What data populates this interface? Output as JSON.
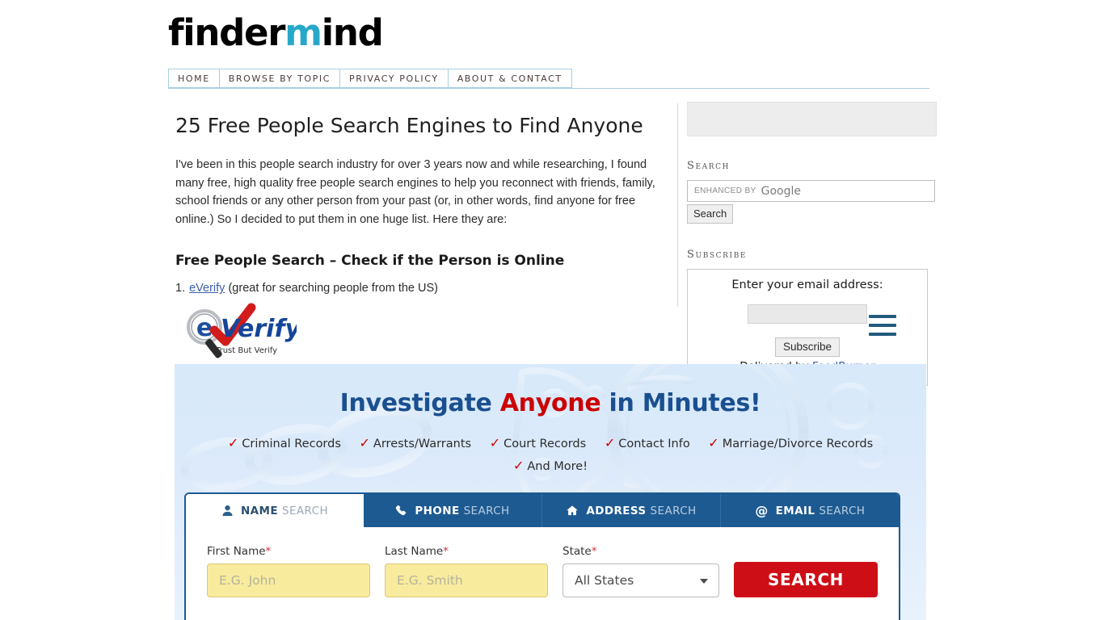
{
  "site": {
    "logo_first": "finder",
    "logo_accent": "m",
    "logo_last": "ind",
    "accent_color": "#28a8c8"
  },
  "nav": {
    "items": [
      {
        "label": "HOME"
      },
      {
        "label": "BROWSE BY TOPIC"
      },
      {
        "label": "PRIVACY POLICY"
      },
      {
        "label": "ABOUT & CONTACT"
      }
    ]
  },
  "article": {
    "title": "25 Free People Search Engines to Find Anyone",
    "intro": "I've been in this people search industry for over 3 years now and while researching, I found many free, high quality free people search engines to help you reconnect with friends, family, school friends or any other person from your past (or, in other words, find anyone for free online.) So I decided to put them in one huge list. Here they are:",
    "subtitle": "Free People Search – Check if the Person is Online",
    "list": [
      {
        "number": "1.",
        "link": "eVerify",
        "rest": "(great for searching people from the US)"
      }
    ],
    "logo_alt": "eVerify",
    "logo_tagline": "Trust But Verify"
  },
  "sidebar": {
    "ad_slot_label": "",
    "search": {
      "title": "Search",
      "enhanced_by": "enhanced by",
      "provider": "Google",
      "placeholder": "",
      "button_label": "Search"
    },
    "subscribe": {
      "title": "Subscribe",
      "prompt": "Enter your email address:",
      "input_value": "",
      "placeholder": "",
      "button_label": "Subscribe",
      "credit_prefix": "Delivered by ",
      "credit_link": "FeedBurner"
    },
    "menu_icon_color": "#215a7d"
  },
  "promo": {
    "headline_pre": "Investigate ",
    "headline_highlight": "Anyone",
    "headline_post": " in Minutes!",
    "highlight_color": "#cc0000",
    "headline_color": "#1a5090",
    "features": [
      "Criminal Records",
      "Arrests/Warrants",
      "Court Records",
      "Contact Info",
      "Marriage/Divorce Records"
    ],
    "features_last": "And More!"
  },
  "search_widget": {
    "tabs": [
      {
        "icon": "person-icon",
        "strong": "NAME",
        "dim": "SEARCH",
        "active": true
      },
      {
        "icon": "phone-icon",
        "strong": "PHONE",
        "dim": "SEARCH",
        "active": false
      },
      {
        "icon": "home-icon",
        "strong": "ADDRESS",
        "dim": "SEARCH",
        "active": false
      },
      {
        "icon": "at-icon",
        "strong": "EMAIL",
        "dim": "SEARCH",
        "active": false
      }
    ],
    "fields": {
      "first_name": {
        "label": "First Name",
        "required_mark": "*",
        "placeholder": "E.G. John",
        "value": ""
      },
      "last_name": {
        "label": "Last Name",
        "required_mark": "*",
        "placeholder": "E.G. Smith",
        "value": ""
      },
      "state": {
        "label": "State",
        "required_mark": "*",
        "selected": "All States"
      }
    },
    "submit_label": "SEARCH",
    "submit_color": "#ce0e16",
    "accent_color": "#1d5a92"
  }
}
